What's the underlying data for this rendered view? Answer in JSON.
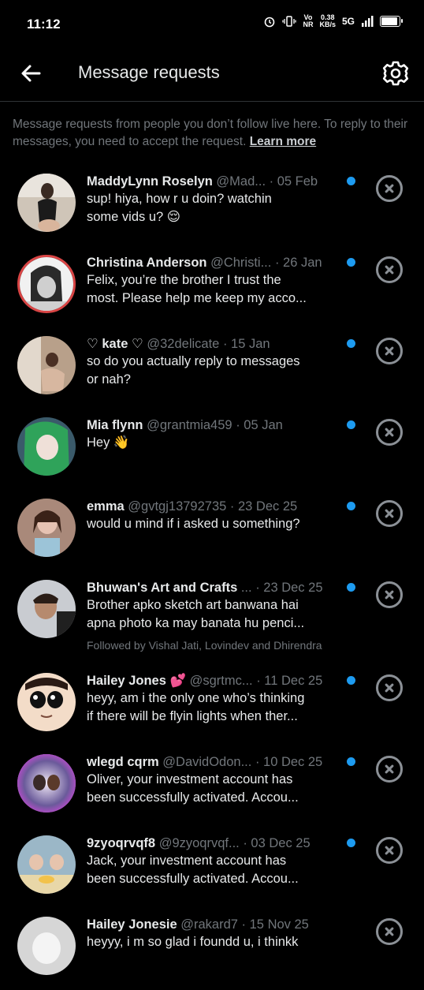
{
  "status_bar": {
    "time": "11:12",
    "speed_value": "0.38",
    "speed_unit": "KB/s",
    "vo_top": "Vo",
    "vo_bottom": "NR",
    "network": "5G"
  },
  "header": {
    "title": "Message requests"
  },
  "notice": {
    "text": "Message requests from people you don’t follow live here. To reply to their messages, you need to accept the request. ",
    "link": "Learn more"
  },
  "requests": [
    {
      "name": "MaddyLynn Roselyn",
      "handle": "@Mad...",
      "date": "· 05 Feb",
      "line1": "sup!  hiya, how r u doin?  watchin",
      "line2": "some vids  u?  😌",
      "sub": ""
    },
    {
      "name": "Christina Anderson",
      "handle": "@Christi...",
      "date": "· 26 Jan",
      "line1": "Felix, you’re the brother I trust the",
      "line2": "most. Please help me keep my acco...",
      "sub": ""
    },
    {
      "name": "♡ kate ♡",
      "handle": "@32delicate",
      "date": "· 15 Jan",
      "line1": "so do you actually reply to messages",
      "line2": "or nah?",
      "sub": ""
    },
    {
      "name": "Mia flynn",
      "handle": "@grantmia459",
      "date": "· 05 Jan",
      "line1": "Hey 👋",
      "line2": "",
      "sub": ""
    },
    {
      "name": "emma",
      "handle": "@gvtgj13792735",
      "date": "· 23 Dec 25",
      "line1": "would u mind if i asked u something?",
      "line2": "",
      "sub": ""
    },
    {
      "name": "Bhuwan's Art and Crafts",
      "handle": "...",
      "date": "· 23 Dec 25",
      "line1": "Brother apko sketch art banwana hai",
      "line2": "apna photo ka  may banata hu penci...",
      "sub": "Followed by Vishal Jati, Lovindev and Dhirendra"
    },
    {
      "name": "Hailey Jones 💕",
      "handle": "@sgrtmc...",
      "date": "· 11 Dec 25",
      "line1": "heyy, am i the only one who’s thinking",
      "line2": "if there will be flyin lights when ther...",
      "sub": ""
    },
    {
      "name": "wlegd cqrm",
      "handle": "@DavidOdon...",
      "date": "· 10 Dec 25",
      "line1": "Oliver, your investment account has",
      "line2": "been successfully activated. Accou...",
      "sub": ""
    },
    {
      "name": "9zyoqrvqf8",
      "handle": "@9zyoqrvqf...",
      "date": "· 03 Dec 25",
      "line1": "Jack, your investment account has",
      "line2": "been successfully activated. Accou...",
      "sub": ""
    },
    {
      "name": "Hailey Jonesie",
      "handle": "@rakard7",
      "date": "· 15 Nov 25",
      "line1": "heyyy, i m so glad i foundd u, i thinkk",
      "line2": "",
      "sub": ""
    }
  ],
  "colors": {
    "background": "#000000",
    "accent": "#1d9bf0",
    "muted": "#71767b"
  }
}
